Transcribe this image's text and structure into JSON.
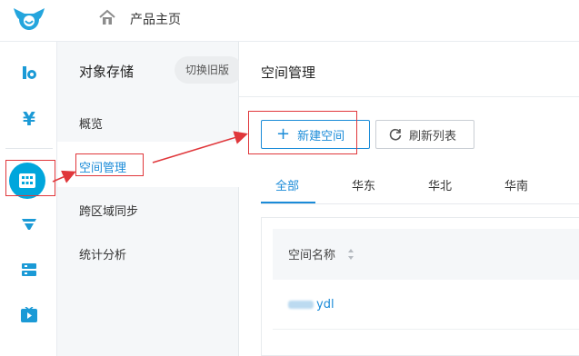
{
  "header": {
    "title": "产品主页"
  },
  "leftbar": {
    "items": [
      {
        "icon": "brand-r-icon"
      },
      {
        "icon": "yen-icon"
      },
      {
        "icon": "grid-storage-icon",
        "active": true
      },
      {
        "icon": "funnel-icon"
      },
      {
        "icon": "server-icon"
      },
      {
        "icon": "video-play-icon"
      }
    ]
  },
  "subnav": {
    "title": "对象存储",
    "switch_label": "切换旧版",
    "items": [
      "概览",
      "空间管理",
      "跨区域同步",
      "统计分析"
    ]
  },
  "main": {
    "title": "空间管理",
    "new_button": "新建空间",
    "refresh_button": "刷新列表",
    "tabs": [
      "全部",
      "华东",
      "华北",
      "华南"
    ],
    "table": {
      "column_name": "空间名称",
      "rows": [
        {
          "name_suffix": "ydl"
        }
      ]
    }
  },
  "colors": {
    "accent": "#1a8bd8",
    "sidebar_active": "#00a6dc",
    "annotation": "#e0373b"
  }
}
